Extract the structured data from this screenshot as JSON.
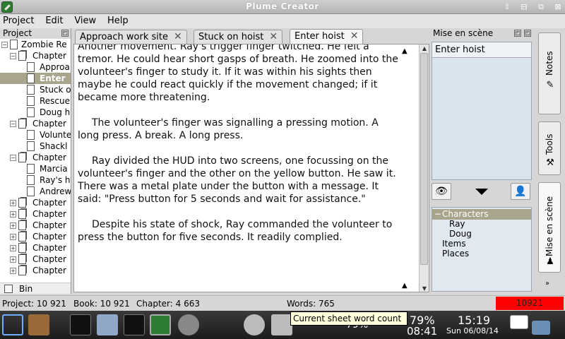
{
  "window": {
    "title": "Plume Creator"
  },
  "menu": [
    "Project",
    "Edit",
    "View",
    "Help"
  ],
  "project_dock": {
    "title": "Project",
    "items": [
      {
        "label": "Zombie Re",
        "level": 0,
        "expand": "−",
        "type": "book"
      },
      {
        "label": "Chapter",
        "level": 1,
        "expand": "−",
        "type": "chapter"
      },
      {
        "label": "Approa",
        "level": 2,
        "expand": "",
        "type": "doc"
      },
      {
        "label": "Enter",
        "level": 2,
        "expand": "",
        "type": "doc",
        "selected": true
      },
      {
        "label": "Stuck o",
        "level": 2,
        "expand": "",
        "type": "doc"
      },
      {
        "label": "Rescue",
        "level": 2,
        "expand": "",
        "type": "doc"
      },
      {
        "label": "Doug h",
        "level": 2,
        "expand": "",
        "type": "doc"
      },
      {
        "label": "Chapter",
        "level": 1,
        "expand": "−",
        "type": "chapter"
      },
      {
        "label": "Volunte",
        "level": 2,
        "expand": "",
        "type": "doc"
      },
      {
        "label": "Shackl",
        "level": 2,
        "expand": "",
        "type": "doc"
      },
      {
        "label": "Chapter",
        "level": 1,
        "expand": "−",
        "type": "chapter"
      },
      {
        "label": "Marcia",
        "level": 2,
        "expand": "",
        "type": "doc"
      },
      {
        "label": "Ray's h",
        "level": 2,
        "expand": "",
        "type": "doc"
      },
      {
        "label": "Andrew",
        "level": 2,
        "expand": "",
        "type": "doc"
      },
      {
        "label": "Chapter",
        "level": 1,
        "expand": "+",
        "type": "chapter"
      },
      {
        "label": "Chapter",
        "level": 1,
        "expand": "+",
        "type": "chapter"
      },
      {
        "label": "Chapter",
        "level": 1,
        "expand": "+",
        "type": "chapter"
      },
      {
        "label": "Chapter",
        "level": 1,
        "expand": "+",
        "type": "chapter"
      },
      {
        "label": "Chapter",
        "level": 1,
        "expand": "+",
        "type": "chapter"
      },
      {
        "label": "Chapter",
        "level": 1,
        "expand": "+",
        "type": "chapter"
      },
      {
        "label": "Chapter",
        "level": 1,
        "expand": "+",
        "type": "chapter"
      }
    ],
    "bin_label": "Bin"
  },
  "tabs": [
    {
      "label": "Approach work site",
      "active": false
    },
    {
      "label": "Stuck on hoist",
      "active": false
    },
    {
      "label": "Enter hoist",
      "active": true
    }
  ],
  "editor": {
    "paragraphs": [
      "Another movement.  Ray's trigger finger twitched.  He felt a tremor.  He could hear short gasps of breath.  He zoomed into the volunteer's finger to study it.  If it was within his sights then maybe he could react quickly if the movement changed; if it became more threatening.",
      "The volunteer's finger was signalling a pressing motion.  A long press.  A break.  A long press.",
      "Ray divided the HUD into two screens, one focussing on the volunteer's finger and the other on the yellow button.  He saw it.  There was a metal plate under the button with a message.  It said: \"Press button for 5 seconds and wait for assistance.\"",
      "Despite his state of shock, Ray commanded the volunteer to press the button for five seconds.  It readily complied."
    ]
  },
  "mise_dock": {
    "title": "Mise en scène",
    "scene_header": "Enter hoist",
    "tree": [
      {
        "label": "Characters",
        "level": 0,
        "expand": "−",
        "selected": true
      },
      {
        "label": "Ray",
        "level": 1
      },
      {
        "label": "Doug",
        "level": 1
      },
      {
        "label": "Items",
        "level": 0
      },
      {
        "label": "Places",
        "level": 0
      }
    ]
  },
  "side_tabs": [
    {
      "label": "Notes",
      "icon": "notes-icon"
    },
    {
      "label": "Tools",
      "icon": "tools-icon"
    },
    {
      "label": "Mise en scène",
      "icon": "person-icon",
      "active": true
    }
  ],
  "status": {
    "project": "Project: 10 921",
    "book": "Book: 10 921",
    "chapter": "Chapter: 4 663",
    "words": "Words: 765",
    "counter": "10921"
  },
  "tooltip": "Current sheet word count",
  "taskbar": {
    "battery_a": "79%",
    "battery_b": "79%",
    "clock_a": "08:41",
    "clock_b": "15:19",
    "date": "Sun 06/08/14"
  },
  "colors": {
    "selection": "#a9a48c",
    "counter_bg": "#ff0000",
    "scene_list_bg": "#d9e4ee"
  }
}
